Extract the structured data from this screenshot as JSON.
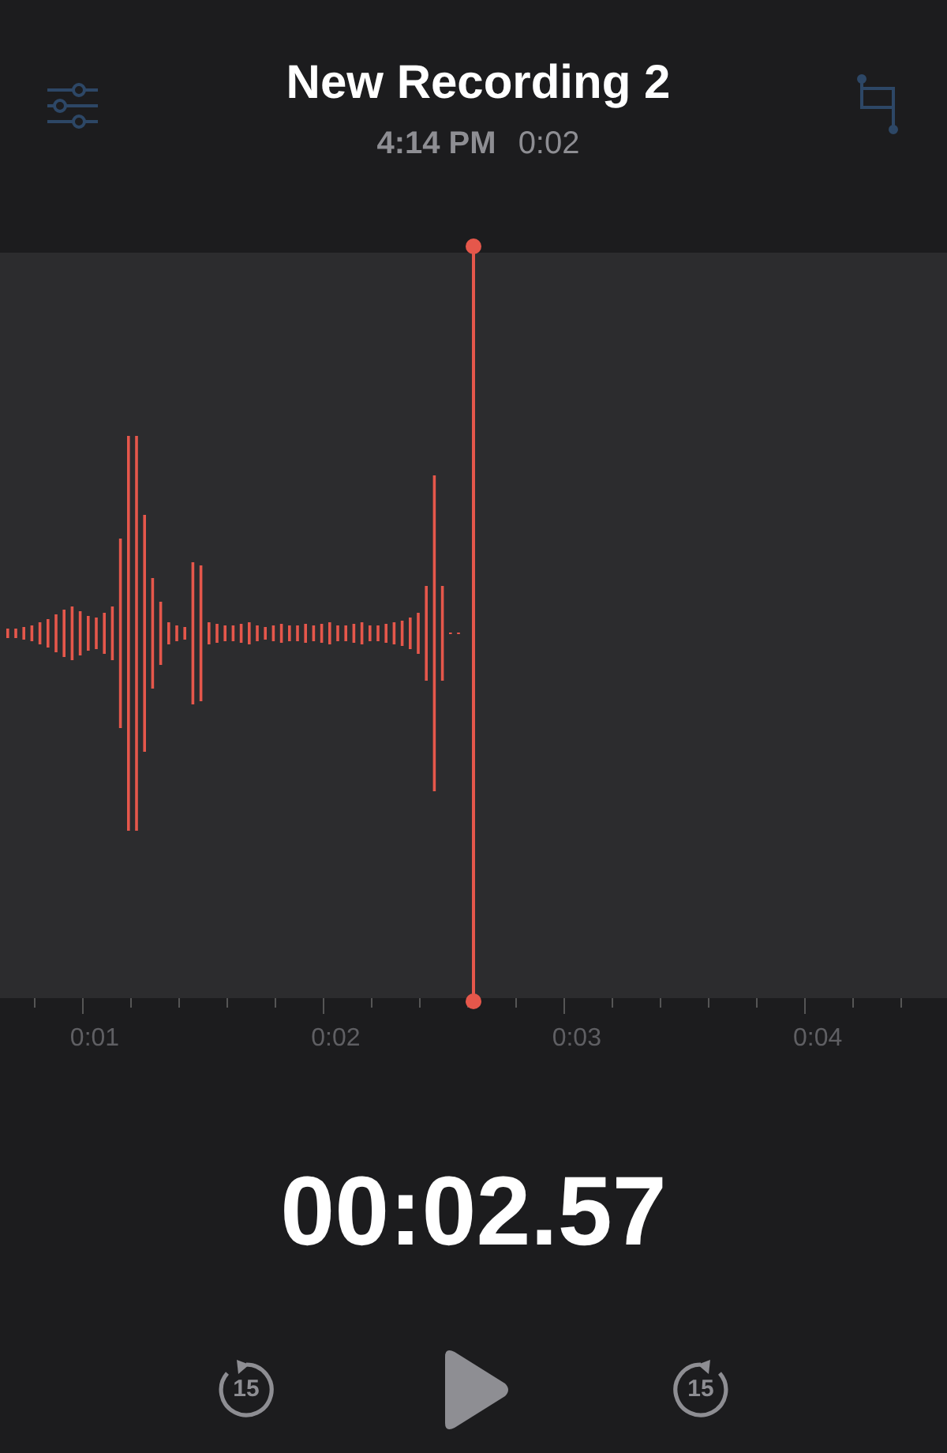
{
  "header": {
    "title": "New Recording 2",
    "time": "4:14 PM",
    "duration": "0:02",
    "options_disabled": true,
    "trim_disabled": true
  },
  "timeline": {
    "ticks": [
      "0:01",
      "0:02",
      "0:03",
      "0:04"
    ]
  },
  "elapsed": "00:02.57",
  "controls": {
    "skip_back": "15",
    "skip_forward": "15"
  }
}
